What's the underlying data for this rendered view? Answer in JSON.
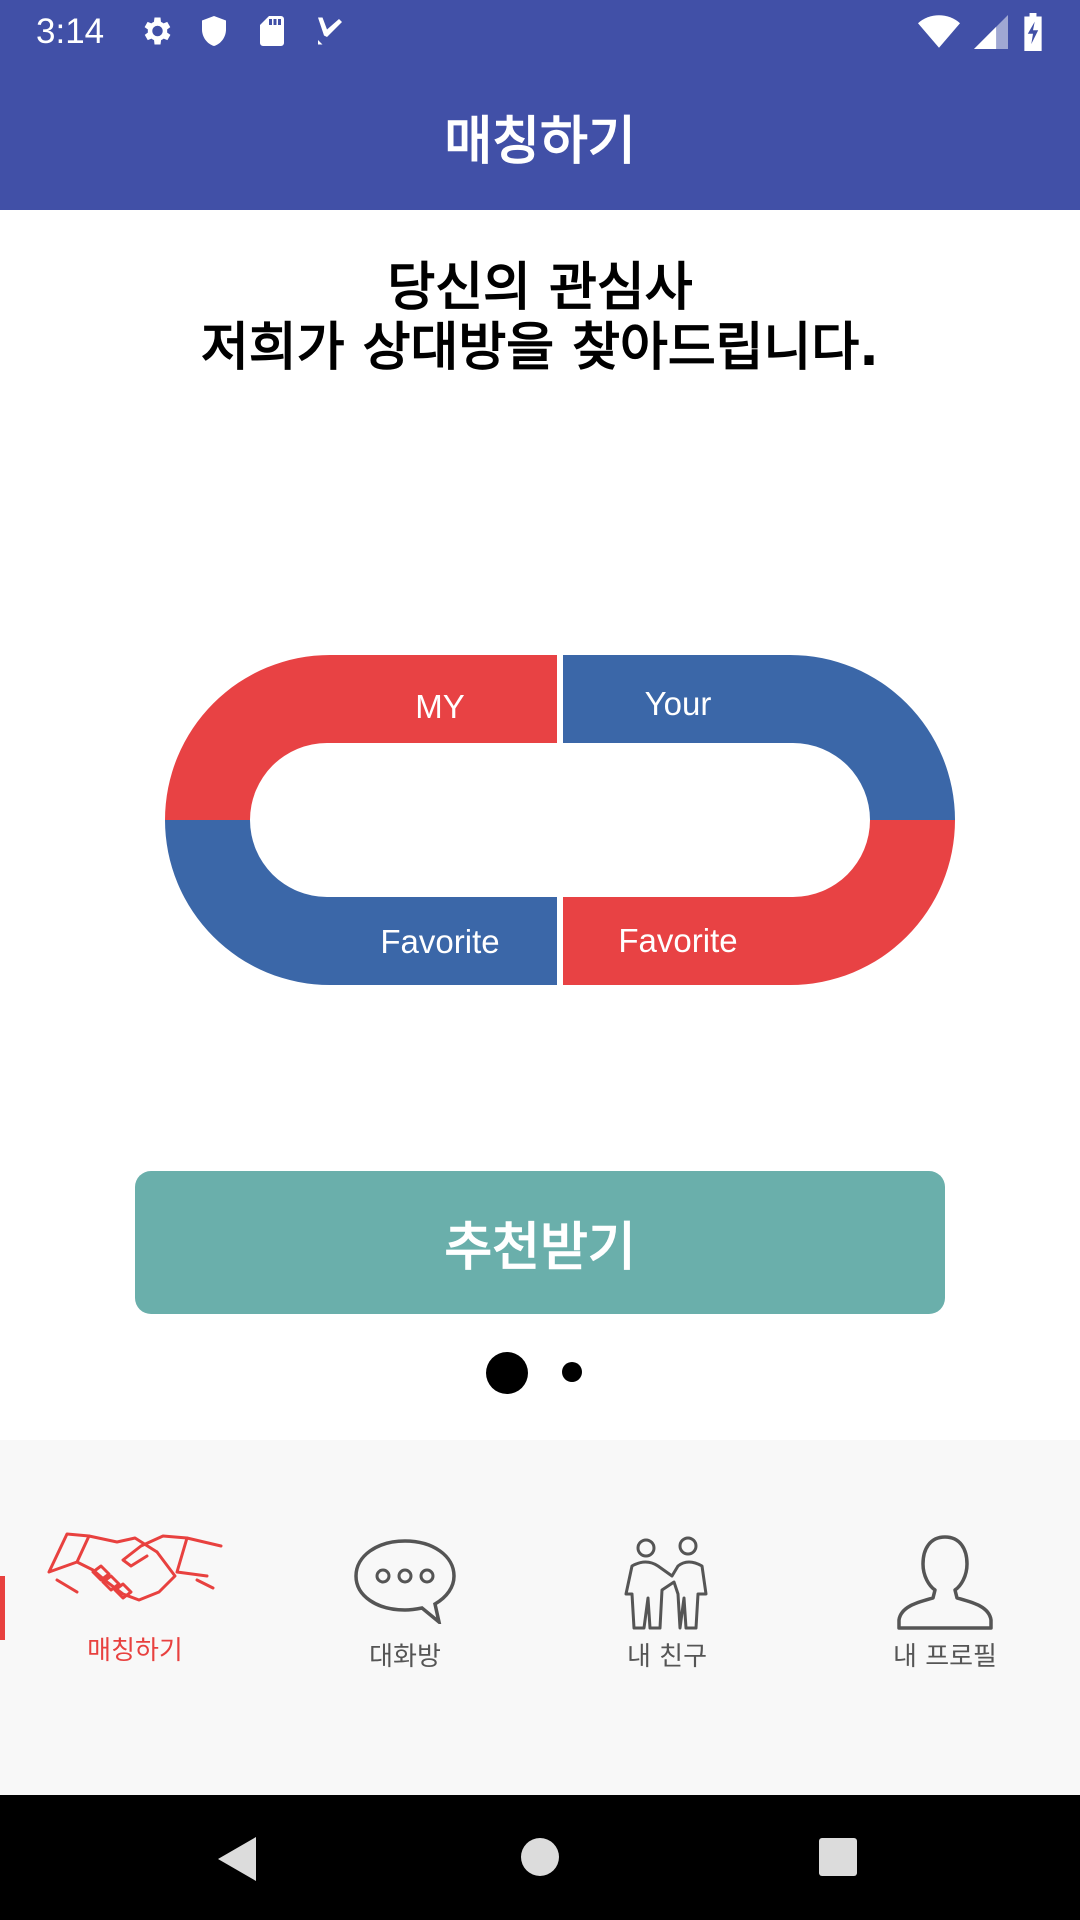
{
  "status_bar": {
    "time": "3:14",
    "left_icons": [
      "settings-icon",
      "shield-icon",
      "sd-card-icon",
      "task-check-icon"
    ],
    "right_icons": [
      "wifi-icon",
      "signal-icon",
      "battery-charging-icon"
    ]
  },
  "app_bar": {
    "title": "매칭하기"
  },
  "main": {
    "headline_line1": "당신의 관심사",
    "headline_line2": "저희가 상대방을 찾아드립니다.",
    "magnet": {
      "top_left": "MY",
      "top_right": "Your",
      "bottom_left": "Favorite",
      "bottom_right": "Favorite",
      "colors": {
        "red": "#e84244",
        "blue": "#3b67a8"
      }
    },
    "recommend_button": "추천받기",
    "pager": {
      "pages": 2,
      "current": 1
    }
  },
  "bottom_nav": {
    "items": [
      {
        "label": "매칭하기",
        "icon": "handshake-icon",
        "active": true
      },
      {
        "label": "대화방",
        "icon": "chat-bubble-icon",
        "active": false
      },
      {
        "label": "내 친구",
        "icon": "friends-icon",
        "active": false
      },
      {
        "label": "내 프로필",
        "icon": "profile-icon",
        "active": false
      }
    ],
    "active_color": "#e8413f"
  },
  "system_nav": [
    "back-icon",
    "home-icon",
    "recents-icon"
  ],
  "colors": {
    "primary": "#4150a7",
    "button": "#6aafab"
  }
}
